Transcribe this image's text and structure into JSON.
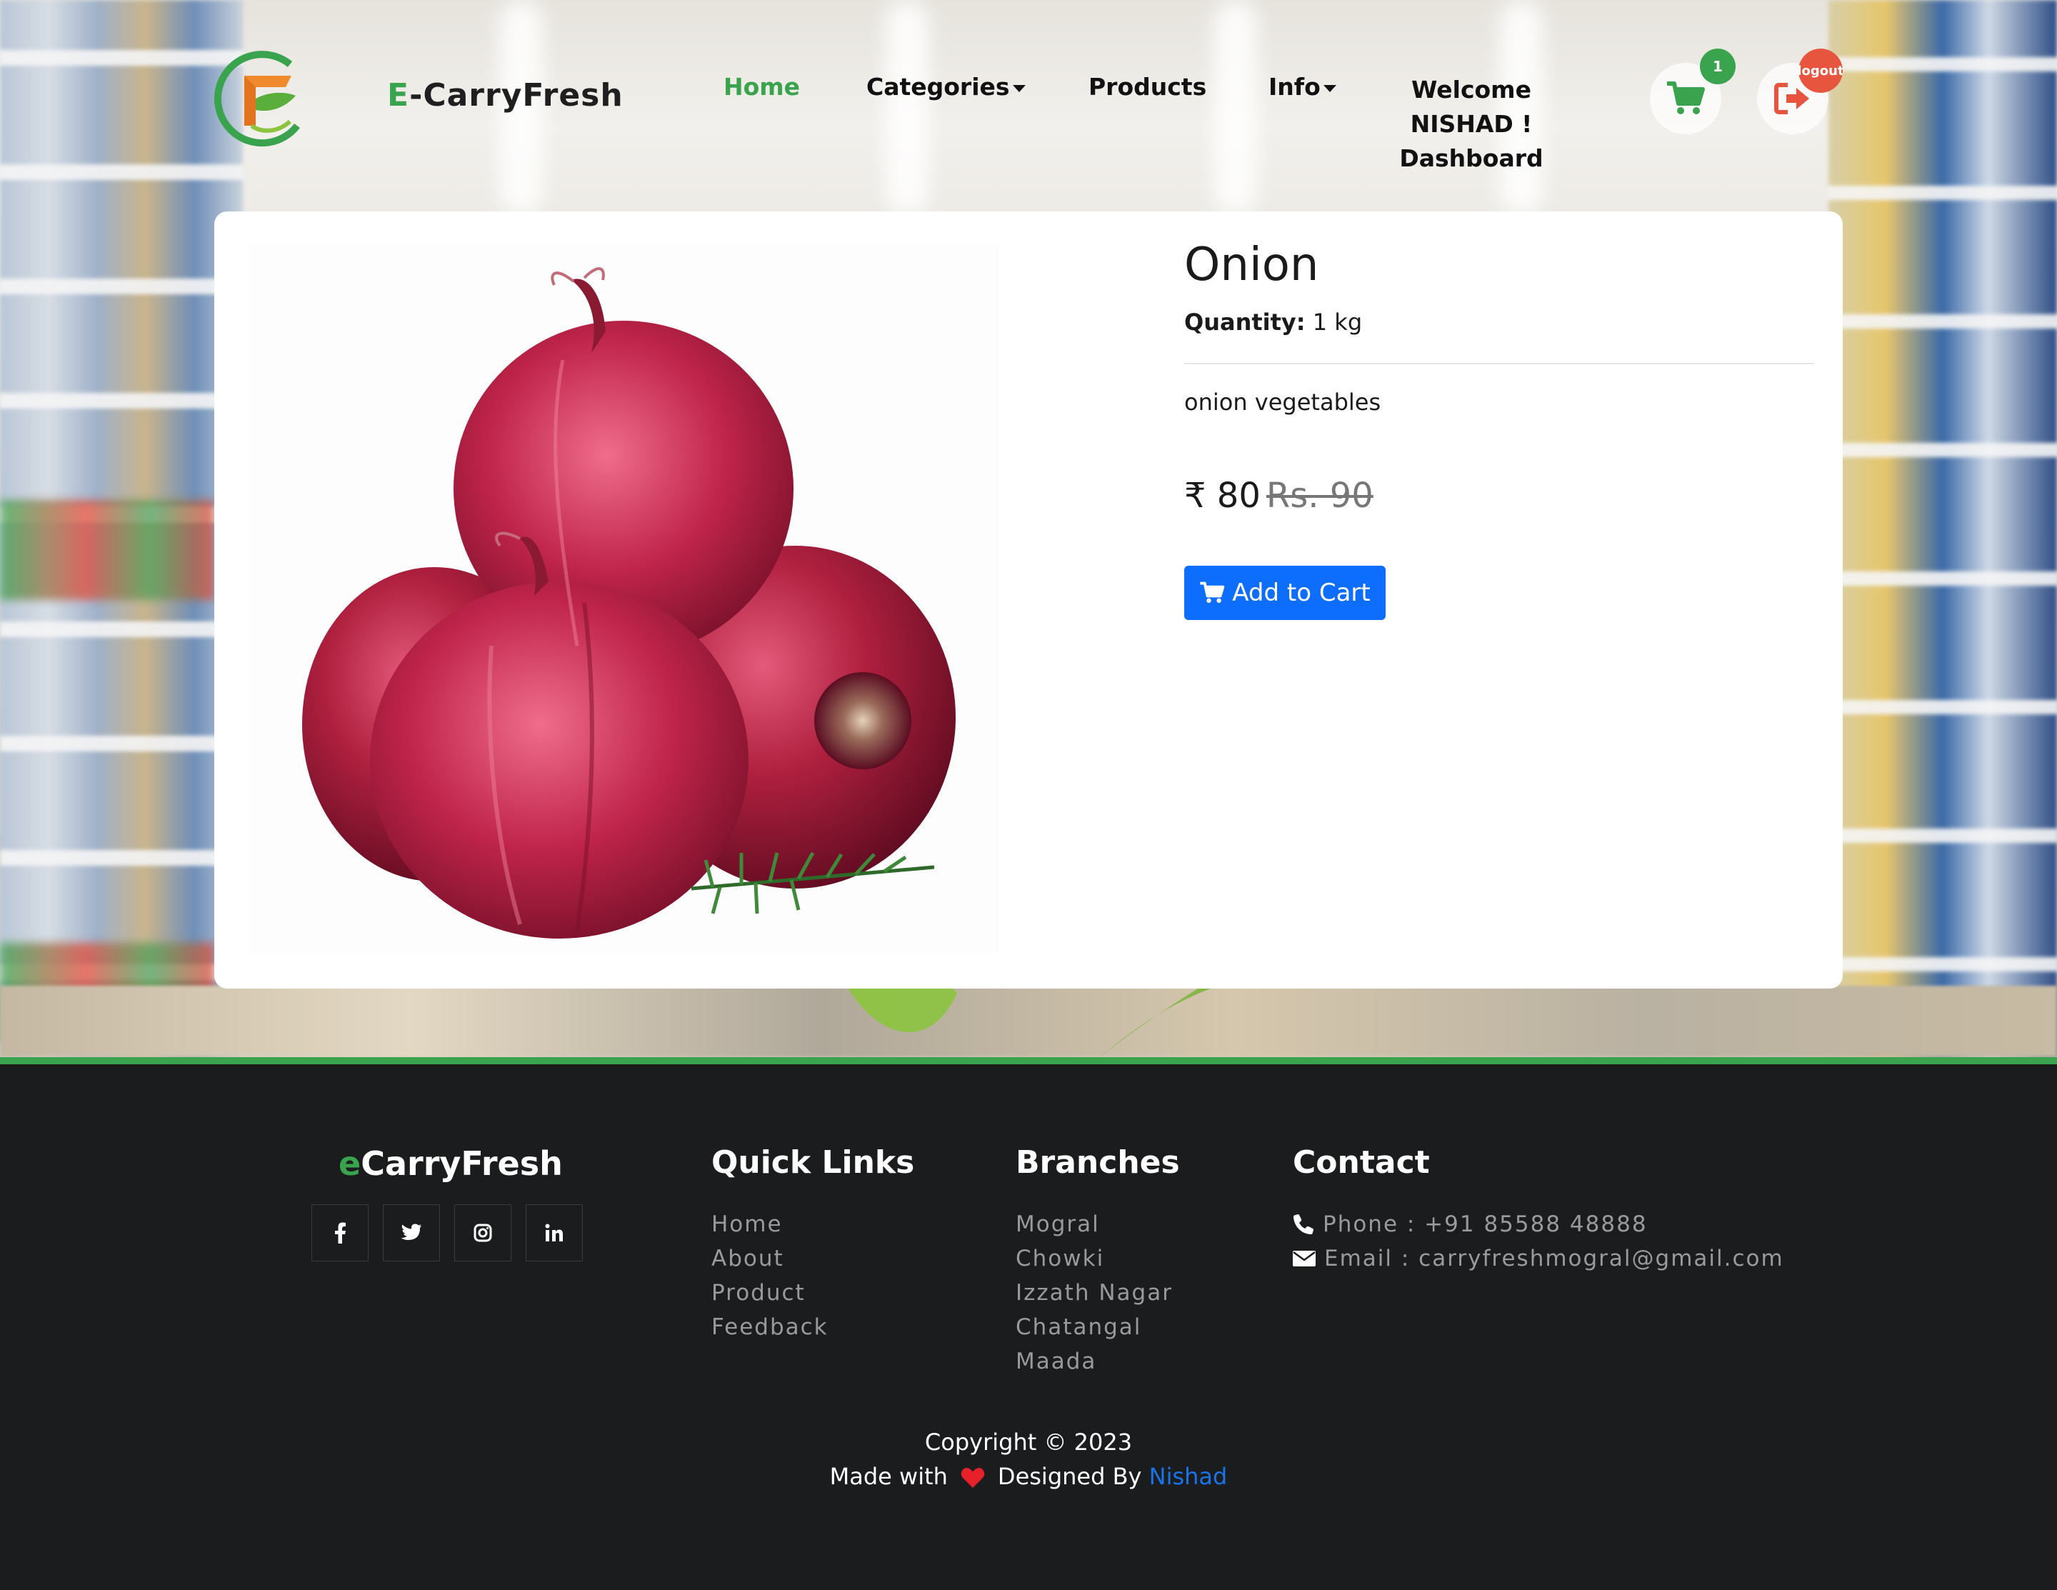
{
  "brand": {
    "prefix": "E",
    "rest": "-CarryFresh"
  },
  "nav": {
    "home": "Home",
    "categories": "Categories",
    "products": "Products",
    "info": "Info",
    "welcome": "Welcome NISHAD !",
    "dashboard": "Dashboard",
    "cart_count": "1",
    "logout_label": "logout"
  },
  "product": {
    "name": "Onion",
    "quantity_label": "Quantity:",
    "quantity_value": "1 kg",
    "description": "onion vegetables",
    "price": "₹ 80",
    "old_price": "Rs. 90",
    "add_to_cart": "Add to Cart"
  },
  "footer": {
    "brand_prefix": "e",
    "brand_rest": "CarryFresh",
    "quick_links": {
      "heading": "Quick Links",
      "items": [
        "Home",
        "About",
        "Product",
        "Feedback"
      ]
    },
    "branches": {
      "heading": "Branches",
      "items": [
        "Mogral",
        "Chowki",
        "Izzath Nagar",
        "Chatangal",
        "Maada"
      ]
    },
    "contact": {
      "heading": "Contact",
      "phone": "Phone : +91 85588 48888",
      "email": "Email : carryfreshmogral@gmail.com"
    },
    "copyright": "Copyright © 2023",
    "made_with": "Made with",
    "designed_by": "Designed By",
    "designer": "Nishad"
  },
  "colors": {
    "accent": "#3aa34e",
    "primary_button": "#0d6efd",
    "logout": "#e8553f",
    "footer_bg": "#1b1c1e"
  }
}
